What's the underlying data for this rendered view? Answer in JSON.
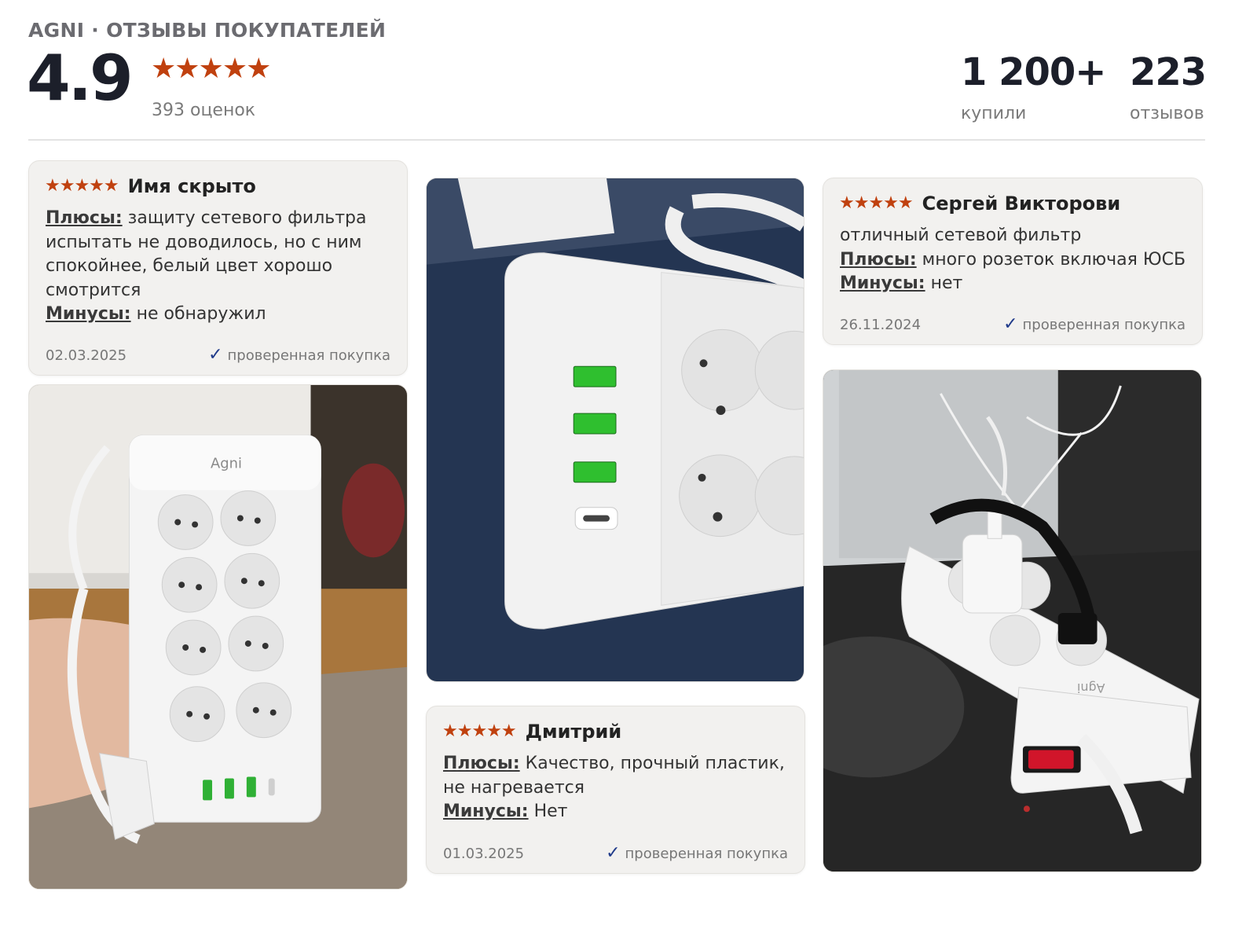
{
  "header": {
    "brand_title": "AGNI · ОТЗЫВЫ ПОКУПАТЕЛЕЙ",
    "rating": "4.9",
    "stars": "★★★★★",
    "ratings_count": "393 оценок",
    "bought_value": "1 200+",
    "bought_label": "купили",
    "reviews_value": "223",
    "reviews_label": "отзывов"
  },
  "reviews": [
    {
      "stars": "★★★★★",
      "author": "Имя скрыто",
      "text": "",
      "pros_label": "Плюсы:",
      "pros": "защиту сетевого фильтра испытать не доводилось, но с ним спокойнее, белый цвет хорошо смотрится",
      "cons_label": "Минусы:",
      "cons": "не обнаружил",
      "date": "02.03.2025",
      "verified": "проверенная покупка"
    },
    {
      "stars": "★★★★★",
      "author": "Дмитрий",
      "text": "",
      "pros_label": "Плюсы:",
      "pros": "Качество, прочный пластик, не нагревается",
      "cons_label": "Минусы:",
      "cons": "Нет",
      "date": "01.03.2025",
      "verified": "проверенная покупка"
    },
    {
      "stars": "★★★★★",
      "author": "Сергей Викторови",
      "text": "отличный сетевой фильтр",
      "pros_label": "Плюсы:",
      "pros": "много розеток включая ЮСБ",
      "cons_label": "Минусы:",
      "cons": "нет",
      "date": "26.11.2024",
      "verified": "проверенная покупка"
    }
  ],
  "photos": {
    "brand_mark": "Agni"
  },
  "colors": {
    "star": "#c0410f",
    "card_bg": "#f2f1ef",
    "verified_check": "#1f3a8a"
  }
}
